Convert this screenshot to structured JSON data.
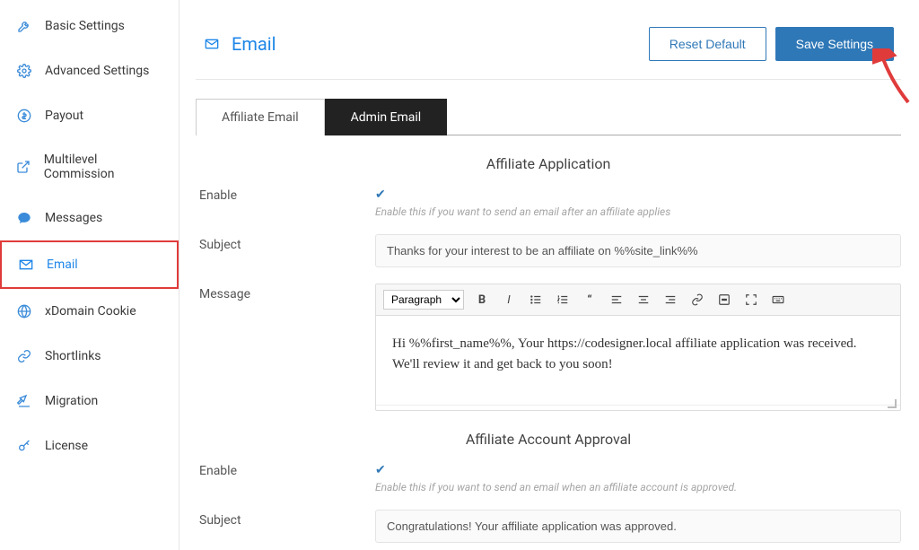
{
  "sidebar": {
    "items": [
      {
        "label": "Basic Settings",
        "icon": "wrench-icon",
        "active": false
      },
      {
        "label": "Advanced Settings",
        "icon": "gear-icon",
        "active": false
      },
      {
        "label": "Payout",
        "icon": "dollar-icon",
        "active": false
      },
      {
        "label": "Multilevel Commission",
        "icon": "external-icon",
        "active": false
      },
      {
        "label": "Messages",
        "icon": "chat-icon",
        "active": false
      },
      {
        "label": "Email",
        "icon": "mail-icon",
        "active": true
      },
      {
        "label": "xDomain Cookie",
        "icon": "globe-icon",
        "active": false
      },
      {
        "label": "Shortlinks",
        "icon": "link-icon",
        "active": false
      },
      {
        "label": "Migration",
        "icon": "migrate-icon",
        "active": false
      },
      {
        "label": "License",
        "icon": "key-icon",
        "active": false
      }
    ]
  },
  "header": {
    "title": "Email",
    "reset_label": "Reset Default",
    "save_label": "Save Settings"
  },
  "tabs": [
    {
      "label": "Affiliate Email",
      "dark": false
    },
    {
      "label": "Admin Email",
      "dark": true
    }
  ],
  "section_application": {
    "title": "Affiliate Application",
    "enable_label": "Enable",
    "enable_hint": "Enable this if you want to send an email after an affiliate applies",
    "subject_label": "Subject",
    "subject_value": "Thanks for your interest to be an affiliate on %%site_link%%",
    "message_label": "Message",
    "editor_format": "Paragraph",
    "message_value": "Hi %%first_name%%, Your https://codesigner.local affiliate application was received. We'll review it and get back to you soon!"
  },
  "section_approval": {
    "title": "Affiliate Account Approval",
    "enable_label": "Enable",
    "enable_hint": "Enable this if you want to send an email when an affiliate account is approved.",
    "subject_label": "Subject",
    "subject_value": "Congratulations! Your affiliate application was approved."
  }
}
